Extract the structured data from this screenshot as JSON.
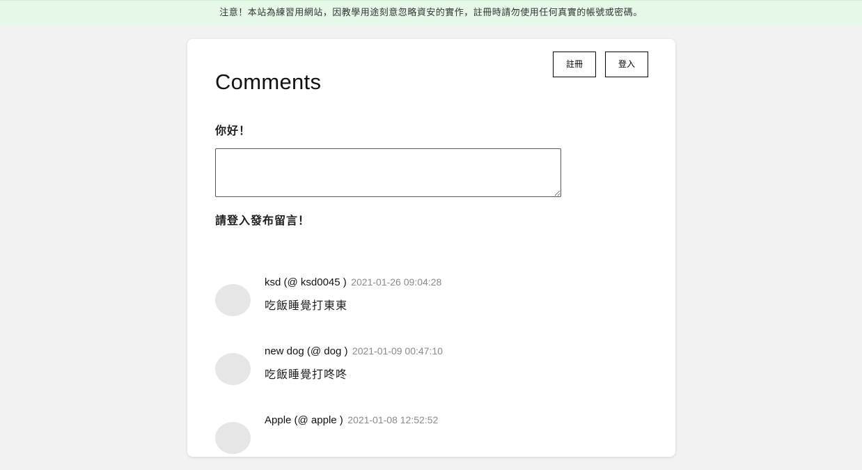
{
  "banner": {
    "text": "注意！本站為練習用網站，因教學用途刻意忽略資安的實作，註冊時請勿使用任何真實的帳號或密碼。"
  },
  "nav": {
    "register_label": "註冊",
    "login_label": "登入"
  },
  "page": {
    "title": "Comments",
    "greeting": "你好！",
    "textarea_value": "",
    "login_prompt": "請登入發布留言！"
  },
  "comments": [
    {
      "author": "ksd (@ ksd0045 )",
      "timestamp": "2021-01-26 09:04:28",
      "content": "吃飯睡覺打東東"
    },
    {
      "author": "new dog (@ dog )",
      "timestamp": "2021-01-09 00:47:10",
      "content": "吃飯睡覺打咚咚"
    },
    {
      "author": "Apple (@ apple )",
      "timestamp": "2021-01-08 12:52:52",
      "content": ""
    }
  ],
  "colors": {
    "background": "#f2f2f2",
    "banner": "#e6f9e8",
    "card": "#ffffff",
    "avatar": "#e6e6e6",
    "timestamp": "#8a8a8a"
  }
}
